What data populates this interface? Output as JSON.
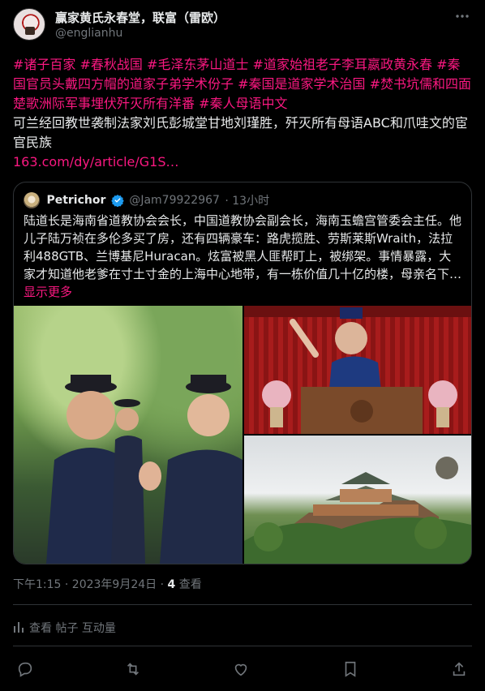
{
  "author": {
    "display_name": "赢家黄氏永春堂，联富（雷欧）",
    "handle": "@englianhu"
  },
  "tweet": {
    "hashtags_line": [
      "#诸子百家",
      "#春秋战国",
      "#毛泽东茅山道士",
      "#道家始祖老子李耳嬴政黄永春",
      "#秦国官员头戴四方帽的道家子弟学术份子",
      "#秦国是道家学术治国",
      "#焚书坑儒和四面楚歌洲际军事埋伏歼灭所有洋番",
      "#秦人母语中文"
    ],
    "body": "可兰经回教世袭制法家刘氏彭城堂甘地刘瑾胜，歼灭所有母语ABC和爪哇文的宦官民族",
    "link": "163.com/dy/article/G1S…"
  },
  "quote": {
    "name": "Petrichor",
    "handle": "@Jam79922967",
    "time": "· 13小时",
    "text": "陆道长是海南省道教协会会长，中国道教协会副会长，海南玉蟾宫管委会主任。他儿子陆万祯在多伦多买了房，还有四辆豪车：路虎揽胜、劳斯莱斯Wraith，法拉利488GTB、兰博基尼Huracan。炫富被黑人匪帮盯上，被绑架。事情暴露，大家才知道他老爹在寸土寸金的上海中心地带，有一栋价值几十亿的楼，母亲名下… ",
    "show_more": "显示更多"
  },
  "meta": {
    "time": "下午1:15 · 2023年9月24日 · ",
    "views_count": "4",
    "views_label": " 查看"
  },
  "analytics": {
    "label": "查看 帖子 互动量"
  },
  "colors": {
    "accent": "#f91880",
    "verified": "#1d9bf0",
    "muted": "#71767b"
  }
}
